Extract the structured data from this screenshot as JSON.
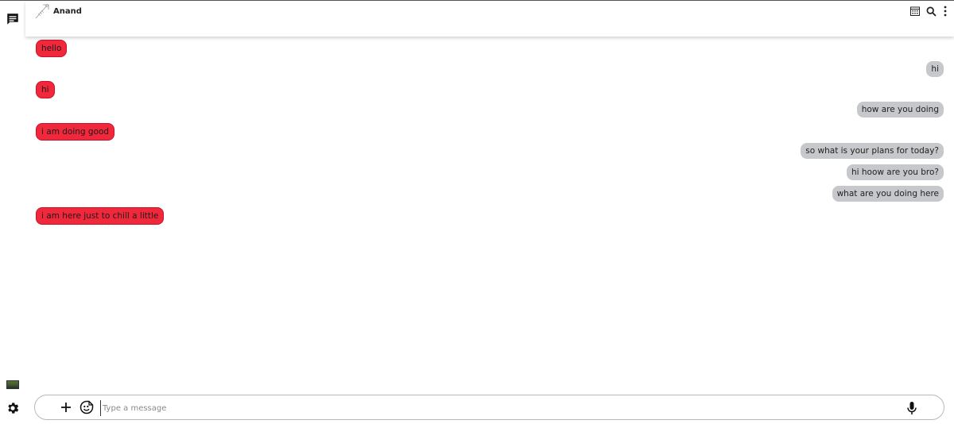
{
  "header": {
    "contact_name": "Anand"
  },
  "icons": {
    "rail_top": "chat-icon",
    "rail_thumb": "image-thumbnail",
    "rail_bottom": "gear-icon",
    "header_avatar": "avatar",
    "header_right": [
      "calendar-icon",
      "search-icon",
      "more-vertical-icon"
    ],
    "composer": [
      "plus-icon",
      "emoji-icon",
      "mic-icon"
    ]
  },
  "messages": [
    {
      "direction": "received",
      "text": "hello"
    },
    {
      "direction": "sent",
      "text": "hi"
    },
    {
      "direction": "received",
      "text": "hi"
    },
    {
      "direction": "sent",
      "text": "how are you doing"
    },
    {
      "direction": "received",
      "text": "i am doing good"
    },
    {
      "direction": "sent",
      "text": "so what is your plans for today?"
    },
    {
      "direction": "sent",
      "text": "hi hoow are you bro?"
    },
    {
      "direction": "sent",
      "text": "what are you doing here"
    },
    {
      "direction": "received",
      "text": "i am here just to chill a little"
    }
  ],
  "composer": {
    "placeholder": "Type a message",
    "value": ""
  },
  "colors": {
    "received_bubble": "#f1283b",
    "sent_bubble": "#c6c8cb",
    "background": "#ffffff"
  }
}
